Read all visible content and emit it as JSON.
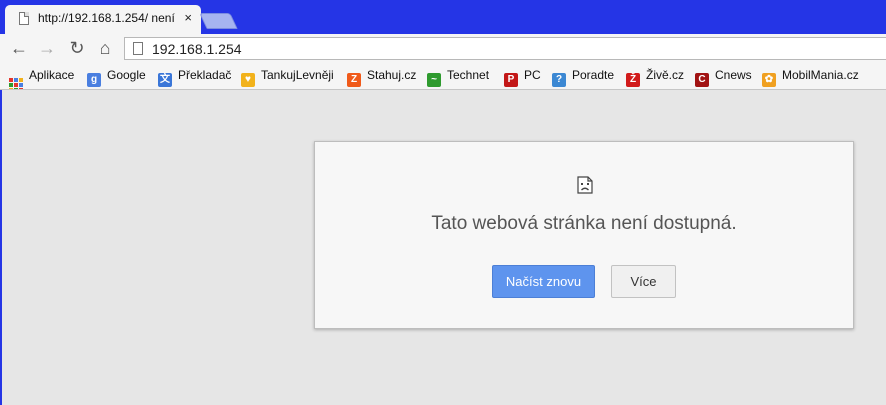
{
  "tab": {
    "title": "http://192.168.1.254/ není",
    "close": "×"
  },
  "nav": {
    "back": "←",
    "forward": "→",
    "reload": "↻",
    "home": "⌂"
  },
  "omnibox": {
    "url": "192.168.1.254"
  },
  "bookmarks": [
    {
      "label": "Aplikace",
      "icon": "apps-grid-icon"
    },
    {
      "label": "Google",
      "icon": "google-icon",
      "color": "#4a7fe0",
      "glyph": "g"
    },
    {
      "label": "Překladač",
      "icon": "translate-icon",
      "color": "#3a76d8",
      "glyph": "文"
    },
    {
      "label": "TankujLevněji",
      "icon": "fuel-icon",
      "color": "#f2b21b",
      "glyph": "♥"
    },
    {
      "label": "Stahuj.cz",
      "icon": "stahuj-icon",
      "color": "#f05a1a",
      "glyph": "Z"
    },
    {
      "label": "Technet",
      "icon": "technet-icon",
      "color": "#2e9a2e",
      "glyph": "~"
    },
    {
      "label": "PC",
      "icon": "pc-icon",
      "color": "#c31717",
      "glyph": "P"
    },
    {
      "label": "Poradte",
      "icon": "poradte-icon",
      "color": "#3c88d3",
      "glyph": "?"
    },
    {
      "label": "Živě.cz",
      "icon": "zive-icon",
      "color": "#d11a1a",
      "glyph": "Ž"
    },
    {
      "label": "Cnews",
      "icon": "cnews-icon",
      "color": "#a11212",
      "glyph": "C"
    },
    {
      "label": "MobilMania.cz",
      "icon": "mobilmania-icon",
      "color": "#f0a020",
      "glyph": "✿"
    }
  ],
  "error": {
    "title": "Tato webová stránka není dostupná.",
    "reload_label": "Načíst znovu",
    "more_label": "Více"
  },
  "colors": {
    "frame": "#2535e6",
    "toolbar": "#f5f5f5",
    "page": "#e6e6e6",
    "primary_button": "#5e94ee"
  }
}
